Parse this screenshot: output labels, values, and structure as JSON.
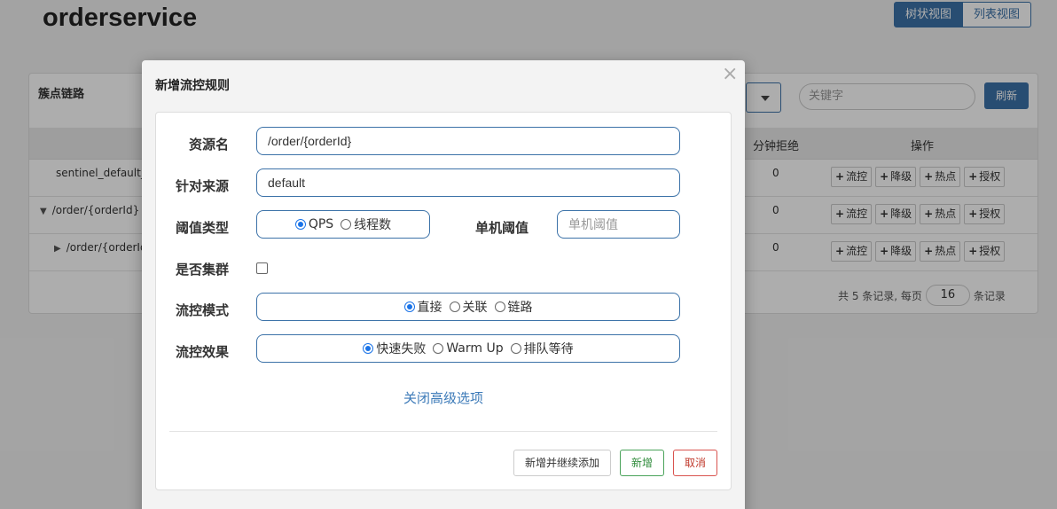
{
  "app": {
    "title": "orderservice"
  },
  "view_toggle": {
    "tree": "树状视图",
    "list": "列表视图"
  },
  "panel": {
    "title": "簇点链路",
    "keyword_placeholder": "关键字",
    "refresh": "刷新",
    "columns": {
      "reject": "分钟拒绝",
      "ops": "操作"
    },
    "rows": [
      {
        "resource": "sentinel_default_co",
        "tri": "",
        "reject": "0"
      },
      {
        "resource": "/order/{orderId}",
        "tri": "▼",
        "reject": "0"
      },
      {
        "resource": "/order/{orderId}",
        "tri": "▶",
        "reject": "0"
      }
    ],
    "ops": {
      "flow": "流控",
      "degrade": "降级",
      "hot": "热点",
      "auth": "授权"
    },
    "pager": {
      "prefix": "共 5 条记录, 每页",
      "size": "16",
      "suffix": "条记录"
    }
  },
  "modal": {
    "title": "新增流控规则",
    "close": "×",
    "resource_label": "资源名",
    "resource_value": "/order/{orderId}",
    "source_label": "针对来源",
    "source_value": "default",
    "threshold_type_label": "阈值类型",
    "threshold_type_options": [
      "QPS",
      "线程数"
    ],
    "single_threshold_label": "单机阈值",
    "single_threshold_placeholder": "单机阈值",
    "cluster_label": "是否集群",
    "mode_label": "流控模式",
    "mode_options": [
      "直接",
      "关联",
      "链路"
    ],
    "effect_label": "流控效果",
    "effect_options": [
      "快速失败",
      "Warm Up",
      "排队等待"
    ],
    "advanced_link": "关闭高级选项",
    "btn_continue": "新增并继续添加",
    "btn_add": "新增",
    "btn_cancel": "取消"
  }
}
